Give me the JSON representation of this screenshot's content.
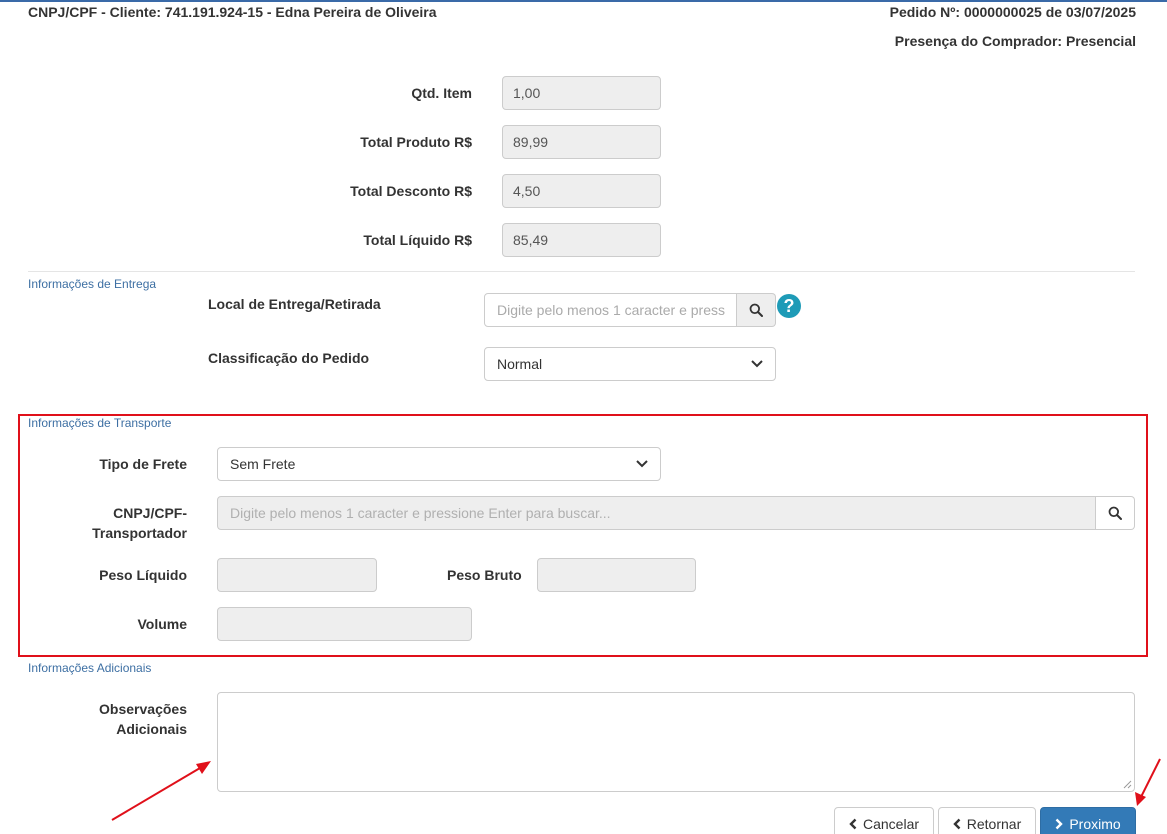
{
  "header": {
    "client": "CNPJ/CPF - Cliente: 741.191.924-15 - Edna Pereira de Oliveira",
    "order": "Pedido Nº: 0000000025 de 03/07/2025",
    "buyer_presence": "Presença do Comprador: Presencial"
  },
  "totals": {
    "qtd_label": "Qtd. Item",
    "qtd_value": "1,00",
    "produto_label": "Total Produto R$",
    "produto_value": "89,99",
    "desconto_label": "Total Desconto R$",
    "desconto_value": "4,50",
    "liquido_label": "Total Líquido R$",
    "liquido_value": "85,49"
  },
  "entrega": {
    "section_title": "Informações de Entrega",
    "local_label": "Local de Entrega/Retirada",
    "local_placeholder": "Digite pelo menos 1 caracter e press",
    "classificacao_label": "Classificação do Pedido",
    "classificacao_value": "Normal",
    "help_glyph": "?"
  },
  "transporte": {
    "section_title": "Informações de Transporte",
    "frete_label": "Tipo de Frete",
    "frete_value": "Sem Frete",
    "transportador_label_1": "CNPJ/CPF-",
    "transportador_label_2": "Transportador",
    "transportador_placeholder": "Digite pelo menos 1 caracter e pressione Enter para buscar...",
    "peso_liquido_label": "Peso Líquido",
    "peso_bruto_label": "Peso Bruto",
    "volume_label": "Volume"
  },
  "adicionais": {
    "section_title": "Informações Adicionais",
    "obs_label_1": "Observações",
    "obs_label_2": "Adicionais"
  },
  "buttons": {
    "cancelar": "Cancelar",
    "retornar": "Retornar",
    "proximo": "Proximo"
  },
  "colors": {
    "highlight_border": "#e0101a",
    "annotation_arrow": "#e0101a",
    "primary_button": "#337ab7",
    "section_title": "#3d6fa3"
  },
  "icons": {
    "search": "search-icon",
    "help": "help-icon",
    "dropdown": "chevron-down-icon",
    "back": "chevron-left-icon",
    "next": "chevron-right-icon"
  }
}
